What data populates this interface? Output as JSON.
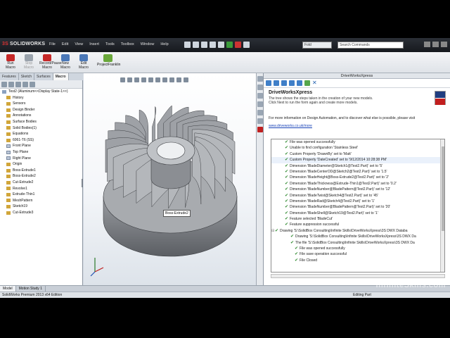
{
  "app": {
    "logo_mark": "3S",
    "logo_text": "SOLIDWORKS",
    "menu": [
      "File",
      "Edit",
      "View",
      "Insert",
      "Tools",
      "Toolbox",
      "Window",
      "Help"
    ],
    "document_field": "Fold",
    "search_placeholder": "Search Commands"
  },
  "ribbon": {
    "buttons": [
      {
        "label": "Run Macro",
        "state": "enabled",
        "color": "#c62828"
      },
      {
        "label": "Stop Macro",
        "state": "disabled",
        "color": "#9aa3ad"
      },
      {
        "label": "Record/Pause Macro",
        "state": "enabled",
        "color": "#c62828"
      },
      {
        "label": "New Macro",
        "state": "enabled",
        "color": "#4a78b8"
      },
      {
        "label": "Edit Macro",
        "state": "enabled",
        "color": "#4a78b8"
      }
    ],
    "extra_button": "ProjectFranklin"
  },
  "panel_tabs": [
    "Features",
    "Sketch",
    "Surfaces",
    "Macro"
  ],
  "tree": {
    "items": [
      {
        "label": "Test2 (Aluminum<<Display State-1>>)",
        "icon": "part",
        "indent": 0
      },
      {
        "label": "History",
        "icon": "feat",
        "indent": 1
      },
      {
        "label": "Sensors",
        "icon": "feat",
        "indent": 1
      },
      {
        "label": "Design Binder",
        "icon": "feat",
        "indent": 1
      },
      {
        "label": "Annotations",
        "icon": "feat",
        "indent": 1
      },
      {
        "label": "Surface Bodies",
        "icon": "feat",
        "indent": 1
      },
      {
        "label": "Solid Bodies(1)",
        "icon": "feat",
        "indent": 1
      },
      {
        "label": "Equations",
        "icon": "feat",
        "indent": 1
      },
      {
        "label": "6061-T6 (SS)",
        "icon": "feat",
        "indent": 1
      },
      {
        "label": "Front Plane",
        "icon": "plane",
        "indent": 1
      },
      {
        "label": "Top Plane",
        "icon": "plane",
        "indent": 1
      },
      {
        "label": "Right Plane",
        "icon": "plane",
        "indent": 1
      },
      {
        "label": "Origin",
        "icon": "feat",
        "indent": 1
      },
      {
        "label": "Boss-Extrude1",
        "icon": "feat",
        "indent": 1
      },
      {
        "label": "Boss-Extrude2",
        "icon": "feat",
        "indent": 1
      },
      {
        "label": "Cut-Extrude2",
        "icon": "feat",
        "indent": 1
      },
      {
        "label": "Revolve1",
        "icon": "feat",
        "indent": 1
      },
      {
        "label": "Extrude-Thin1",
        "icon": "feat",
        "indent": 1
      },
      {
        "label": "MeshPattern",
        "icon": "feat",
        "indent": 1
      },
      {
        "label": "Sketch19",
        "icon": "feat",
        "indent": 1
      },
      {
        "label": "Cut-Extrude3",
        "icon": "feat",
        "indent": 1
      }
    ]
  },
  "viewport": {
    "tooltip": "Boss-Extrude2"
  },
  "bottom_tabs": [
    "Model",
    "Motion Study 1"
  ],
  "status": {
    "left": "SolidWorks Premium 2013 x64 Edition",
    "right": "Editing Part"
  },
  "driveworks": {
    "window_title": "DriveWorksXpress",
    "name": "DriveWorksXpress",
    "desc1": "The tree shows the steps taken in the creation of your new models.",
    "desc2": "Click Next to run the form again and create more models.",
    "info": "For more information on Design Automation, and to discover what else is possible, please visit",
    "link": "www.driveworks.co.uk/more",
    "log": [
      {
        "text": "File was opened successfully",
        "indent": 1,
        "check": true
      },
      {
        "text": "Unable to find configuration 'Stainless Steel'",
        "indent": 1,
        "check": true
      },
      {
        "text": "Custom Property 'DrawnBy' set to 'Matt'",
        "indent": 1,
        "check": true
      },
      {
        "text": "Custom Property 'DateCreated' set to '9/12/2014 10:28:38 PM'",
        "indent": 1,
        "check": true
      },
      {
        "text": "Dimension 'BladeDiameter@Sketch1@Test2.Part)' set to '5'",
        "indent": 1,
        "check": true
      },
      {
        "text": "Dimension 'BladeCenterOD@Sketch2@Test2.Part)' set to '1.5'",
        "indent": 1,
        "check": true
      },
      {
        "text": "Dimension 'BladeHeight@Boss-Extrude2@Test2.Part)' set to '2'",
        "indent": 1,
        "check": true
      },
      {
        "text": "Dimension 'BladeThickness@Extrude-Thin1@Test2.Part)' set to '0.2'",
        "indent": 1,
        "check": true
      },
      {
        "text": "Dimension 'BladeNumber@BladePattern@Test2.Part)' set to '12'",
        "indent": 1,
        "check": true
      },
      {
        "text": "Dimension 'BladeTwist@Sketch4@Test2.Part)' set to '45'",
        "indent": 1,
        "check": true
      },
      {
        "text": "Dimension 'BladeRad@Sketch4@Test2.Part)' set to '1'",
        "indent": 1,
        "check": true
      },
      {
        "text": "Dimension 'BladeNumber@BladePattern@Test2.Part)' set to '20'",
        "indent": 1,
        "check": true
      },
      {
        "text": "Dimension 'BladeShell@Sketch19@Test2.Part)' set to '1'",
        "indent": 1,
        "check": true
      },
      {
        "text": "Feature selected 'BladeCut'",
        "indent": 1,
        "check": true
      },
      {
        "text": "Feature suppression successful",
        "indent": 1,
        "check": true
      },
      {
        "text": "Drawing 'S:\\SolidBox Consulting\\Infinite Skills\\DriveWorksXpress\\3S DWX Databa",
        "indent": 0,
        "check": true,
        "twisty": true
      },
      {
        "text": "Drawing 'S:\\SolidBox Consulting\\Infinite Skills\\DriveWorksXpress\\3S DWX Da",
        "indent": 2,
        "check": true
      },
      {
        "text": "The file 'S:\\SolidBox Consulting\\Infinite Skills\\DriveWorksXpress\\3S DWX Da",
        "indent": 2,
        "check": true
      },
      {
        "text": "File was opened successfully",
        "indent": 3,
        "check": true
      },
      {
        "text": "File save operation successful",
        "indent": 3,
        "check": true
      },
      {
        "text": "File Closed",
        "indent": 3,
        "check": true
      }
    ]
  },
  "watermark": "InfiniteSkills.com",
  "colors": {
    "accent": "#c62828",
    "link": "#1a44b8",
    "check": "#2f8a2f"
  }
}
